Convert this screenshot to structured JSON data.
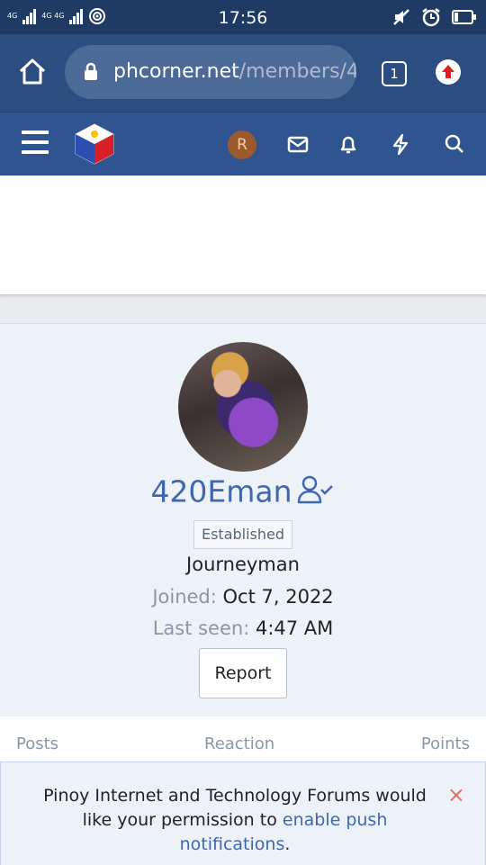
{
  "status_bar": {
    "time": "17:56",
    "network_left": "4G",
    "network_right": "4G 4G",
    "icons": [
      "signal-icon",
      "wifi-icon",
      "mute-icon",
      "alarm-icon",
      "battery-icon"
    ]
  },
  "browser": {
    "url_domain": "phcorner.net",
    "url_path": "/members/4",
    "tab_count": "1"
  },
  "site_header": {
    "avatar_letter": "R",
    "icons": [
      "menu-icon",
      "site-logo",
      "mail-icon",
      "bell-icon",
      "lightning-icon",
      "search-icon"
    ]
  },
  "profile": {
    "username": "420Eman",
    "badge": "Established",
    "rank": "Journeyman",
    "joined_label": "Joined:",
    "joined_value": "Oct 7, 2022",
    "last_seen_label": "Last seen:",
    "last_seen_value": "4:47 AM",
    "report_label": "Report"
  },
  "stats": {
    "posts_label": "Posts",
    "reaction_label": "Reaction",
    "points_label": "Points"
  },
  "push_banner": {
    "text_before": "Pinoy Internet and Technology Forums would like your permission to ",
    "link_text": "enable push notifications",
    "text_after": ".",
    "close_symbol": "×"
  },
  "colors": {
    "status_bar": "#1f3a63",
    "browser_bar": "#2c4d80",
    "site_header": "#2f5490",
    "accent_link": "#3f67b0",
    "close_red": "#d9756a"
  }
}
